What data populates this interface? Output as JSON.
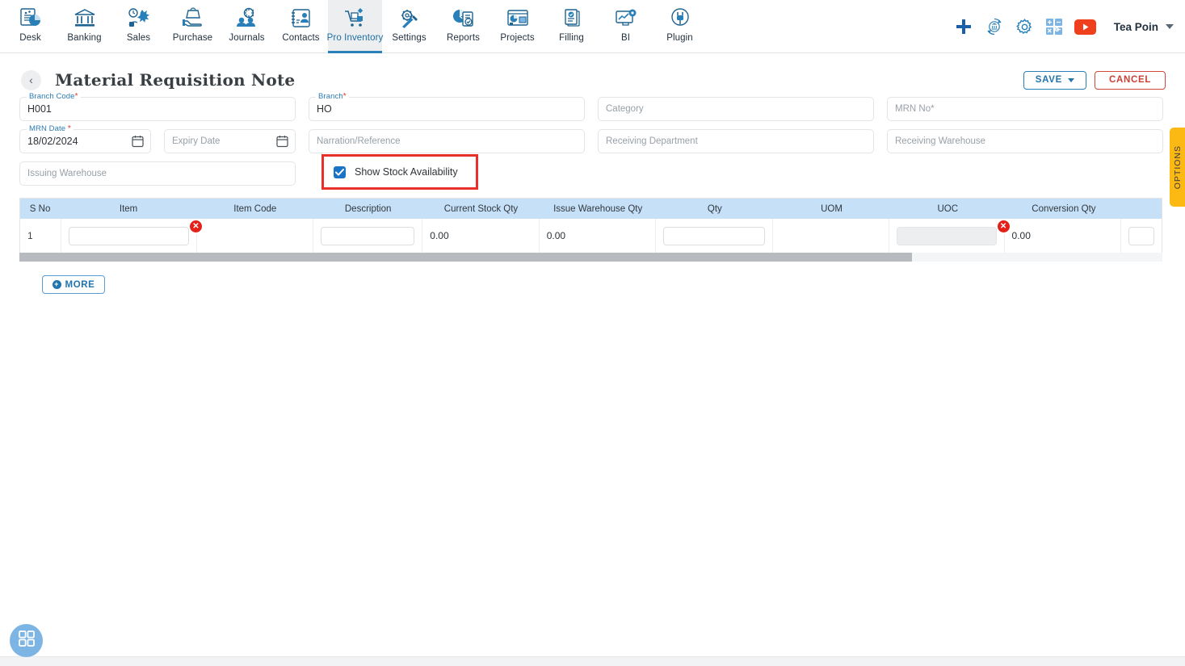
{
  "nav": {
    "items": [
      {
        "label": "Desk",
        "icon": "dashboard-icon",
        "active": false
      },
      {
        "label": "Banking",
        "icon": "bank-icon",
        "active": false
      },
      {
        "label": "Sales",
        "icon": "sales-icon",
        "active": false
      },
      {
        "label": "Purchase",
        "icon": "purchase-icon",
        "active": false
      },
      {
        "label": "Journals",
        "icon": "journals-icon",
        "active": false
      },
      {
        "label": "Contacts",
        "icon": "contacts-icon",
        "active": false
      },
      {
        "label": "Pro Inventory",
        "icon": "inventory-icon",
        "active": true
      },
      {
        "label": "Settings",
        "icon": "settings-icon",
        "active": false
      },
      {
        "label": "Reports",
        "icon": "reports-icon",
        "active": false
      },
      {
        "label": "Projects",
        "icon": "projects-icon",
        "active": false
      },
      {
        "label": "Filling",
        "icon": "filling-icon",
        "active": false
      },
      {
        "label": "BI",
        "icon": "bi-icon",
        "active": false
      },
      {
        "label": "Plugin",
        "icon": "plugin-icon",
        "active": false
      }
    ],
    "right_icons": [
      {
        "name": "add-icon"
      },
      {
        "name": "bank-sync-icon"
      },
      {
        "name": "gear-icon"
      },
      {
        "name": "calculator-icon"
      },
      {
        "name": "youtube-icon"
      }
    ],
    "user": "Tea Poin",
    "accent": "#2980b9"
  },
  "header": {
    "back_label": "‹",
    "title": "Material Requisition Note",
    "save_label": "SAVE",
    "cancel_label": "CANCEL"
  },
  "form": {
    "branch_code": {
      "label": "Branch Code",
      "required": "*",
      "value": "H001"
    },
    "branch": {
      "label": "Branch",
      "required": "*",
      "value": "HO"
    },
    "category": {
      "placeholder": "Category"
    },
    "mrn_no": {
      "placeholder": "MRN No",
      "required": "*"
    },
    "mrn_date": {
      "label": "MRN Date",
      "required": "*",
      "value": "18/02/2024",
      "icon": "calendar-icon"
    },
    "expiry_date": {
      "placeholder": "Expiry Date",
      "icon": "calendar-icon"
    },
    "narration": {
      "placeholder": "Narration/Reference"
    },
    "receiving_department": {
      "placeholder": "Receiving Department"
    },
    "receiving_warehouse": {
      "placeholder": "Receiving Warehouse"
    },
    "issuing_warehouse": {
      "placeholder": "Issuing Warehouse"
    },
    "show_stock": {
      "label": "Show Stock Availability",
      "checked": true,
      "highlight_color": "#e8302a"
    }
  },
  "grid": {
    "columns": [
      "S No",
      "Item",
      "Item Code",
      "Description",
      "Current Stock Qty",
      "Issue Warehouse Qty",
      "Qty",
      "UOM",
      "UOC",
      "Conversion Qty"
    ],
    "rows": [
      {
        "s_no": "1",
        "item": "",
        "item_code": "",
        "description": "",
        "current_stock_qty": "0.00",
        "issue_warehouse_qty": "0.00",
        "qty": "",
        "uom": "",
        "uoc": "",
        "conversion_qty": "0.00",
        "item_error": "✕",
        "uoc_error": "✕"
      }
    ],
    "header_bg": "#c6e0f7"
  },
  "more_button": {
    "label": "MORE",
    "icon": "plus-circle-icon"
  },
  "options_tab": {
    "label": "OPTIONS",
    "color": "#fdb913"
  },
  "fab": {
    "name": "grid-apps-icon"
  }
}
